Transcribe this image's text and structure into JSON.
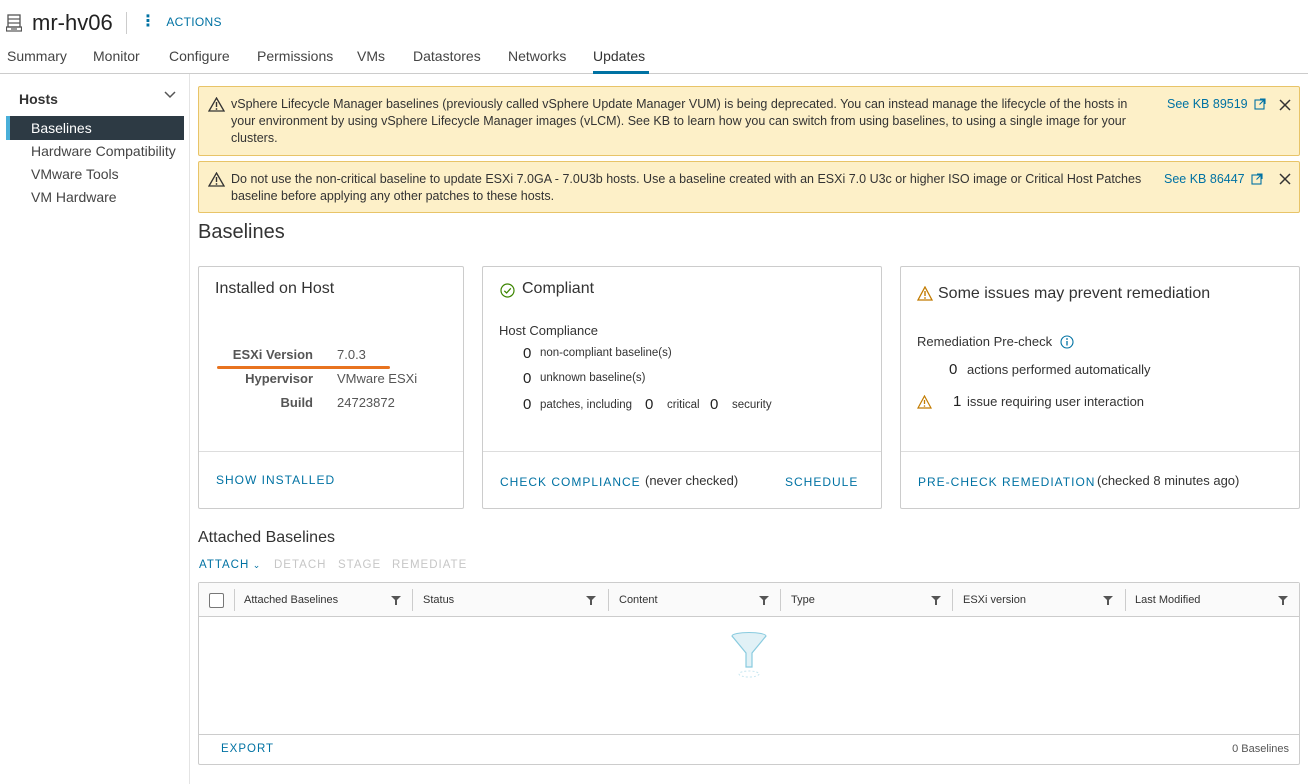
{
  "header": {
    "title": "mr-hv06",
    "actions_label": "ACTIONS"
  },
  "tabs": [
    "Summary",
    "Monitor",
    "Configure",
    "Permissions",
    "VMs",
    "Datastores",
    "Networks",
    "Updates"
  ],
  "active_tab": "Updates",
  "sidebar": {
    "section": "Hosts",
    "items": [
      "Baselines",
      "Hardware Compatibility",
      "VMware Tools",
      "VM Hardware"
    ],
    "active": "Baselines"
  },
  "alerts": [
    {
      "lines": [
        "vSphere Lifecycle Manager baselines (previously called vSphere Update Manager VUM) is being deprecated. You can instead manage the lifecycle of the hosts in",
        "your environment by using vSphere Lifecycle Manager images (vLCM). See KB to learn how you can switch from using baselines, to using a single image for your",
        "clusters."
      ],
      "link": "See KB 89519"
    },
    {
      "lines": [
        "Do not use the non-critical baseline to update ESXi 7.0GA - 7.0U3b hosts. Use a baseline created with an ESXi 7.0 U3c or higher ISO image or Critical Host Patches",
        "baseline before applying any other patches to these hosts."
      ],
      "link": "See KB 86447"
    }
  ],
  "page_title": "Baselines",
  "installed_card": {
    "title": "Installed on Host",
    "rows": [
      {
        "label": "ESXi Version",
        "value": "7.0.3"
      },
      {
        "label": "Hypervisor",
        "value": "VMware ESXi"
      },
      {
        "label": "Build",
        "value": "24723872"
      }
    ],
    "action": "SHOW INSTALLED"
  },
  "compliance_card": {
    "title": "Compliant",
    "section": "Host Compliance",
    "noncompliant_count": "0",
    "noncompliant_label": "non-compliant baseline(s)",
    "unknown_count": "0",
    "unknown_label": "unknown baseline(s)",
    "patches_count": "0",
    "patches_label": "patches, including",
    "critical_count": "0",
    "critical_label": "critical",
    "security_count": "0",
    "security_label": "security",
    "action": "CHECK COMPLIANCE",
    "status": "(never checked)",
    "schedule": "SCHEDULE"
  },
  "remediation_card": {
    "title": "Some issues may prevent remediation",
    "section": "Remediation Pre-check",
    "auto_count": "0",
    "auto_label": "actions performed automatically",
    "issue_count": "1",
    "issue_label": "issue requiring user interaction",
    "action": "PRE-CHECK REMEDIATION",
    "status": "(checked 8 minutes ago)"
  },
  "attached": {
    "title": "Attached Baselines",
    "toolbar": {
      "attach": "ATTACH",
      "detach": "DETACH",
      "stage": "STAGE",
      "remediate": "REMEDIATE"
    },
    "columns": [
      "Attached Baselines",
      "Status",
      "Content",
      "Type",
      "ESXi version",
      "Last Modified"
    ],
    "export": "EXPORT",
    "count": "0 Baselines"
  },
  "colors": {
    "accent": "#0072a3",
    "warning_bg": "#fdf0c8",
    "sidebar_active": "#2d3a44",
    "highlight": "#e8731f"
  },
  "icons": [
    "host-icon",
    "kebab-icon",
    "chevron-down-icon",
    "warning-icon",
    "external-link-icon",
    "close-icon",
    "check-circle-icon",
    "info-icon",
    "filter-icon",
    "empty-filter-icon"
  ]
}
